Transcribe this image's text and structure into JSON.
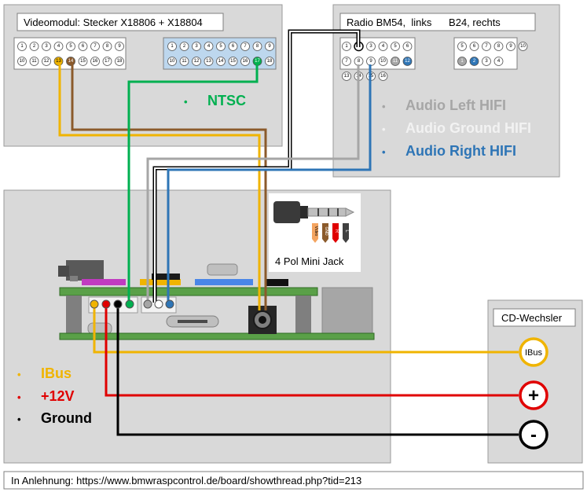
{
  "video_module": {
    "title": "Videomodul:  Stecker X18806 + X18804",
    "left_connector_pins": [
      "1",
      "2",
      "3",
      "4",
      "5",
      "6",
      "7",
      "8",
      "9",
      "10",
      "11",
      "12",
      "13",
      "14",
      "15",
      "16",
      "17",
      "18"
    ],
    "right_connector_pins": [
      "1",
      "2",
      "3",
      "4",
      "5",
      "6",
      "7",
      "8",
      "9",
      "10",
      "11",
      "12",
      "13",
      "14",
      "15",
      "16",
      "17",
      "18"
    ],
    "legend": {
      "bullet": "•",
      "text": "NTSC"
    }
  },
  "radio": {
    "title": "Radio BM54,  links      B24, rechts",
    "left_connector_pins": [
      "1",
      "2",
      "3",
      "4",
      "5",
      "6",
      "7",
      "8",
      "9",
      "10",
      "11",
      "12",
      "13",
      "14",
      "15",
      "16"
    ],
    "right_connector_pins": [
      "5",
      "6",
      "7",
      "8",
      "9",
      "10",
      "1",
      "2",
      "3",
      "4"
    ],
    "legend": [
      {
        "bullet": "•",
        "text": "Audio Left HIFI",
        "color": "#a6a6a6"
      },
      {
        "bullet": "•",
        "text": "Audio Ground HIFI",
        "color": "#d9d9d9"
      },
      {
        "bullet": "•",
        "text": "Audio Right HIFI",
        "color": "#2e75b6"
      }
    ]
  },
  "jack": {
    "label": "4 Pol Mini Jack",
    "plug_labels": [
      "Video",
      "GND",
      "R",
      "L"
    ]
  },
  "cd_changer": {
    "title": "CD-Wechsler",
    "ibus_label": "IBus",
    "plus_label": "+",
    "minus_label": "-"
  },
  "power_legend": [
    {
      "bullet": "•",
      "text": "IBus",
      "color": "#f0b400"
    },
    {
      "bullet": "•",
      "text": "+12V",
      "color": "#e00000"
    },
    {
      "bullet": "•",
      "text": "Ground",
      "color": "#000000"
    }
  ],
  "footer": {
    "text": "In Anlehnung: https://www.bmwraspcontrol.de/board/showthread.php?tid=213"
  },
  "colors": {
    "panel_bg": "#d9d9d9",
    "ntsc_green": "#00b050",
    "ibus_yellow": "#f0b400",
    "brown": "#8b5a2b",
    "plus_red": "#e00000",
    "gnd_black": "#000000",
    "audio_right_blue": "#2e75b6",
    "audio_left_gray": "#a6a6a6",
    "audio_ground_white": "#ffffff"
  }
}
